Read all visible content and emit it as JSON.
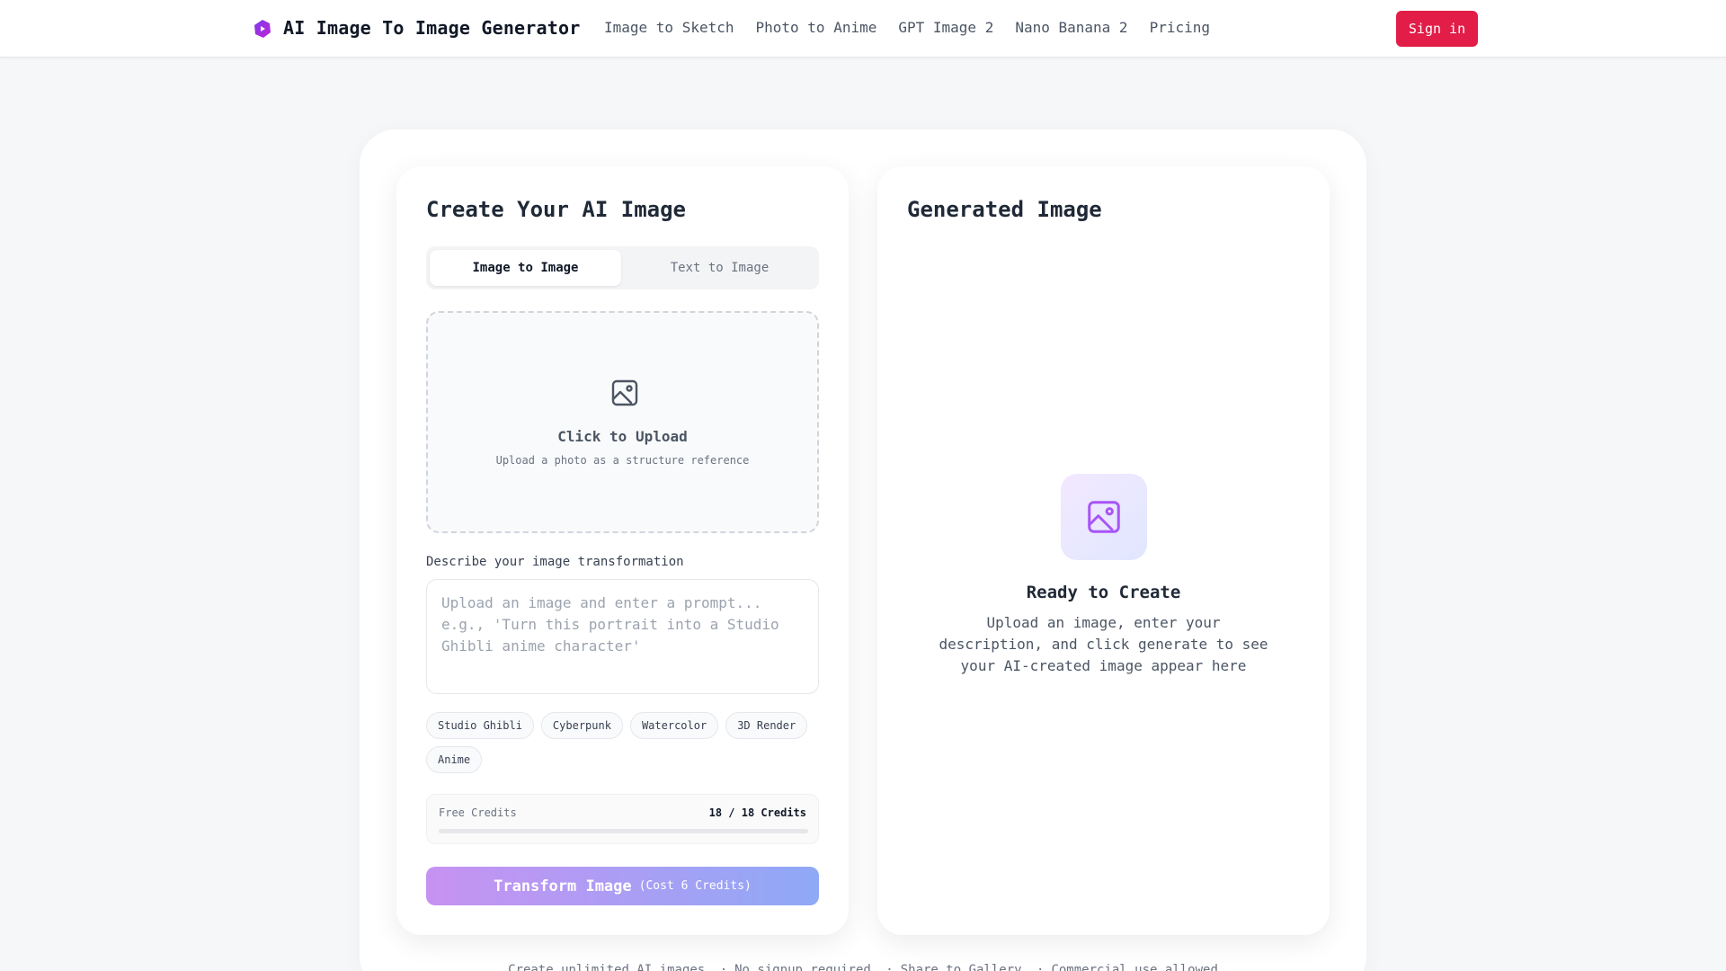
{
  "header": {
    "brand": "AI Image To Image Generator",
    "logo_icon": "purple-blob-logo-icon",
    "nav": [
      "Image to Sketch",
      "Photo to Anime",
      "GPT Image 2",
      "Nano Banana 2",
      "Pricing"
    ],
    "signin_label": "Sign in"
  },
  "left": {
    "title": "Create Your AI Image",
    "tabs": [
      {
        "label": "Image to Image",
        "active": true
      },
      {
        "label": "Text to Image",
        "active": false
      }
    ],
    "upload": {
      "icon": "image-icon",
      "title": "Click to Upload",
      "subtitle": "Upload a photo as a structure reference"
    },
    "prompt": {
      "label": "Describe your image transformation",
      "value": "",
      "placeholder": "Upload an image and enter a prompt... e.g., 'Turn this portrait into a Studio Ghibli anime character'"
    },
    "styles": [
      "Studio Ghibli",
      "Cyberpunk",
      "Watercolor",
      "3D Render",
      "Anime"
    ],
    "credits": {
      "label": "Free Credits",
      "value": "18 / 18 Credits",
      "used_fraction": 0
    },
    "transform": {
      "label": "Transform Image",
      "cost": "(Cost 6 Credits)"
    }
  },
  "right": {
    "title": "Generated Image",
    "icon": "image-icon",
    "ready_title": "Ready to Create",
    "ready_desc": "Upload an image, enter your description, and click generate to see your AI-created image appear here"
  },
  "footer": {
    "items": [
      "Create unlimited AI images",
      "No signup required",
      "Share to Gallery",
      "Commercial use allowed"
    ]
  },
  "colors": {
    "accent": "#e11d48",
    "gradient_start": "#c792f2",
    "gradient_end": "#8fa9f6",
    "icon_purple": "#a855f7"
  }
}
